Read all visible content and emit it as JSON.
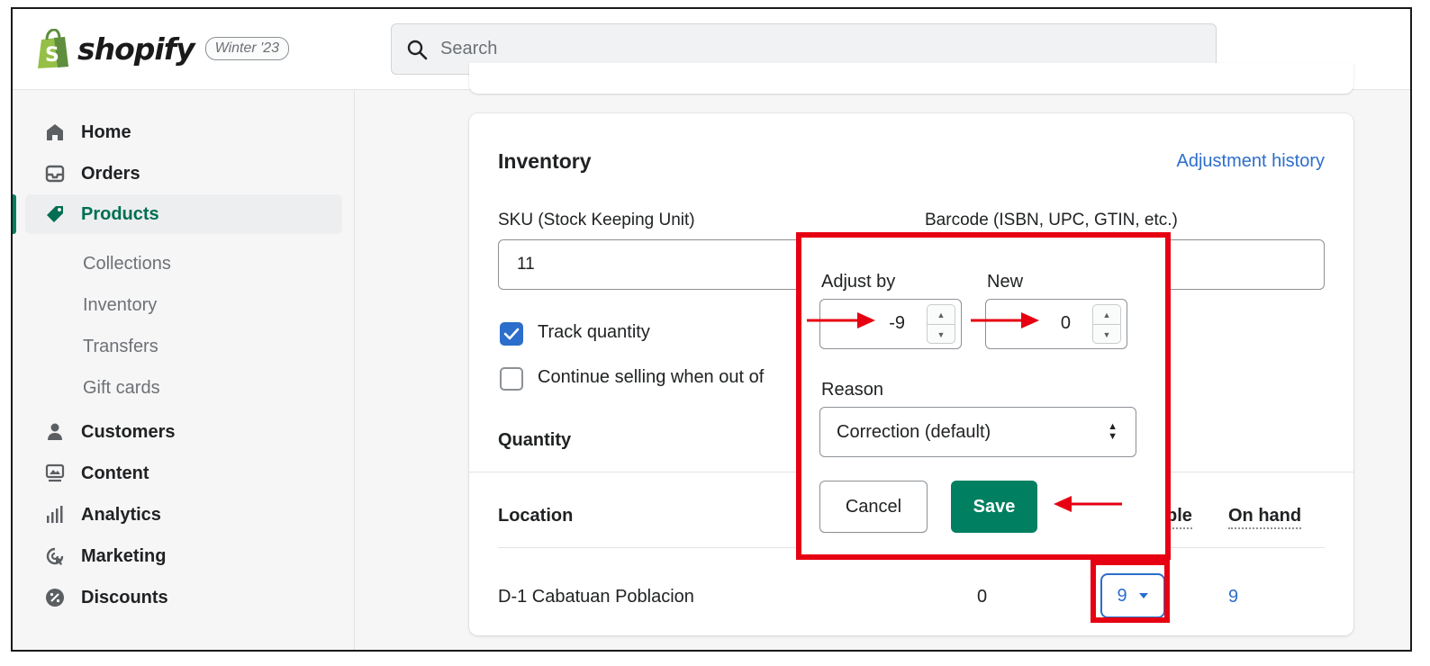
{
  "header": {
    "brand": "shopify",
    "edition_badge": "Winter '23",
    "search_placeholder": "Search"
  },
  "sidebar": {
    "items": [
      {
        "label": "Home",
        "icon": "home-icon"
      },
      {
        "label": "Orders",
        "icon": "orders-icon"
      },
      {
        "label": "Products",
        "icon": "tag-icon",
        "active": true
      },
      {
        "label": "Customers",
        "icon": "person-icon"
      },
      {
        "label": "Content",
        "icon": "content-icon"
      },
      {
        "label": "Analytics",
        "icon": "analytics-icon"
      },
      {
        "label": "Marketing",
        "icon": "marketing-icon"
      },
      {
        "label": "Discounts",
        "icon": "discount-icon"
      }
    ],
    "product_subitems": [
      "Collections",
      "Inventory",
      "Transfers",
      "Gift cards"
    ]
  },
  "inventory": {
    "title": "Inventory",
    "adjustment_link": "Adjustment history",
    "sku_label": "SKU (Stock Keeping Unit)",
    "sku_value": "11",
    "barcode_label": "Barcode (ISBN, UPC, GTIN, etc.)",
    "track_quantity_label": "Track quantity",
    "track_quantity_checked": true,
    "continue_selling_label": "Continue selling when out of",
    "continue_selling_checked": false,
    "quantity_heading": "Quantity",
    "table": {
      "col_location": "Location",
      "col_available_partial": "ble",
      "col_on_hand": "On hand",
      "rows": [
        {
          "location": "D-1 Cabatuan Poblacion",
          "committed": "0",
          "available": "9",
          "on_hand": "9"
        }
      ]
    }
  },
  "popover": {
    "adjust_by_label": "Adjust by",
    "adjust_by_value": "-9",
    "new_label": "New",
    "new_value": "0",
    "reason_label": "Reason",
    "reason_value": "Correction (default)",
    "cancel_label": "Cancel",
    "save_label": "Save"
  },
  "colors": {
    "accent_green": "#008060",
    "link_blue": "#2c6ecb",
    "annotation_red": "#e60012"
  }
}
